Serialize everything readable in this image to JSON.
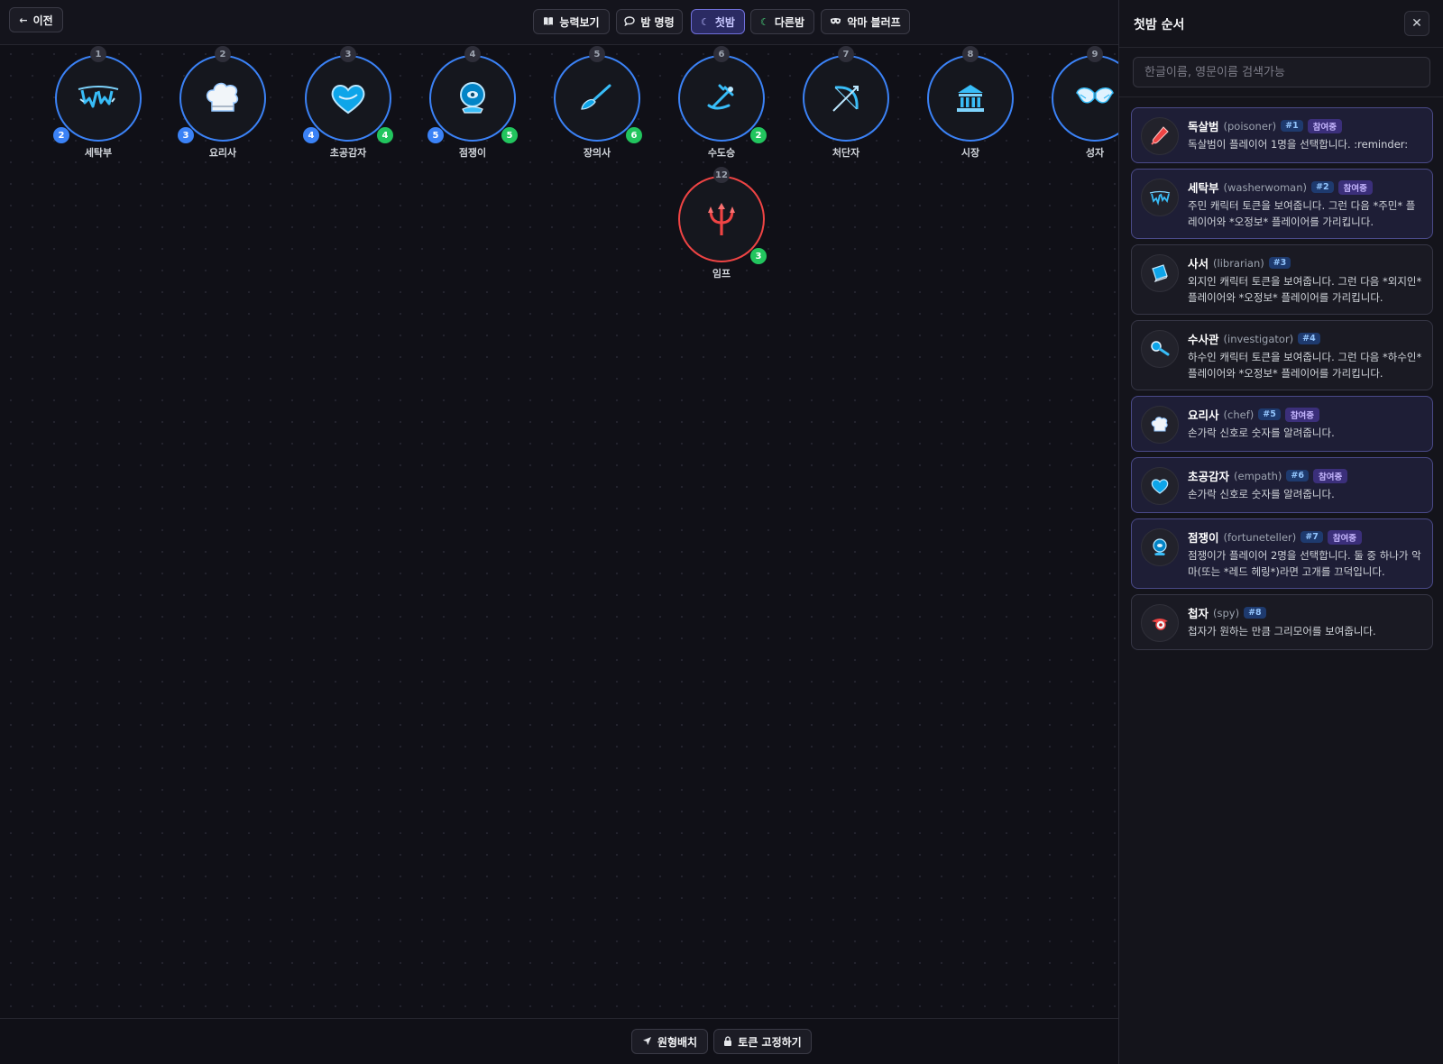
{
  "toolbar": {
    "back_label": "이전",
    "tabs": [
      {
        "label": "능력보기",
        "icon": "book-icon"
      },
      {
        "label": "밤 명령",
        "icon": "chat-bubble-icon"
      },
      {
        "label": "첫밤",
        "icon": "moon-icon",
        "active": true
      },
      {
        "label": "다른밤",
        "icon": "moon-icon"
      },
      {
        "label": "악마 블러프",
        "icon": "mask-icon"
      }
    ]
  },
  "tokens": [
    {
      "seat": "1",
      "name": "세탁부",
      "blue": "2",
      "green": ""
    },
    {
      "seat": "2",
      "name": "요리사",
      "blue": "3",
      "green": ""
    },
    {
      "seat": "3",
      "name": "초공감자",
      "blue": "4",
      "green": "4"
    },
    {
      "seat": "4",
      "name": "점쟁이",
      "blue": "5",
      "green": "5"
    },
    {
      "seat": "5",
      "name": "장의사",
      "blue": "",
      "green": "6"
    },
    {
      "seat": "6",
      "name": "수도승",
      "blue": "",
      "green": "2"
    },
    {
      "seat": "7",
      "name": "처단자",
      "blue": "",
      "green": ""
    },
    {
      "seat": "8",
      "name": "시장",
      "blue": "",
      "green": ""
    },
    {
      "seat": "9",
      "name": "성자",
      "blue": "",
      "green": ""
    },
    {
      "seat": "12",
      "name": "임프",
      "blue": "",
      "green": "3",
      "evil": true
    }
  ],
  "bottom": {
    "circle_label": "원형배치",
    "lock_label": "토큰 고정하기"
  },
  "panel": {
    "title": "첫밤 순서",
    "close": "✕",
    "search_placeholder": "한글이름, 영문이름 검색가능",
    "items": [
      {
        "kname": "독살범",
        "ename": "(poisoner)",
        "order": "#1",
        "joined": "참여중",
        "desc": "독살범이 플레이어 1명을 선택합니다. :reminder:"
      },
      {
        "kname": "세탁부",
        "ename": "(washerwoman)",
        "order": "#2",
        "joined": "참여중",
        "desc": "주민 캐릭터 토큰을 보여줍니다. 그런 다음 *주민* 플레이어와 *오정보* 플레이어를 가리킵니다."
      },
      {
        "kname": "사서",
        "ename": "(librarian)",
        "order": "#3",
        "joined": "",
        "desc": "외지인 캐릭터 토큰을 보여줍니다. 그런 다음 *외지인* 플레이어와 *오정보* 플레이어를 가리킵니다."
      },
      {
        "kname": "수사관",
        "ename": "(investigator)",
        "order": "#4",
        "joined": "",
        "desc": "하수인 캐릭터 토큰을 보여줍니다. 그런 다음 *하수인* 플레이어와 *오정보* 플레이어를 가리킵니다."
      },
      {
        "kname": "요리사",
        "ename": "(chef)",
        "order": "#5",
        "joined": "참여중",
        "desc": "손가락 신호로 숫자를 알려줍니다."
      },
      {
        "kname": "초공감자",
        "ename": "(empath)",
        "order": "#6",
        "joined": "참여중",
        "desc": "손가락 신호로 숫자를 알려줍니다."
      },
      {
        "kname": "점쟁이",
        "ename": "(fortuneteller)",
        "order": "#7",
        "joined": "참여중",
        "desc": "점쟁이가 플레이어 2명을 선택합니다. 둘 중 하나가 악마(또는 *레드 헤링*)라면 고개를 끄덕입니다."
      },
      {
        "kname": "첩자",
        "ename": "(spy)",
        "order": "#8",
        "joined": "",
        "desc": "첩자가 원하는 만큼 그리모어를 보여줍니다."
      }
    ]
  }
}
